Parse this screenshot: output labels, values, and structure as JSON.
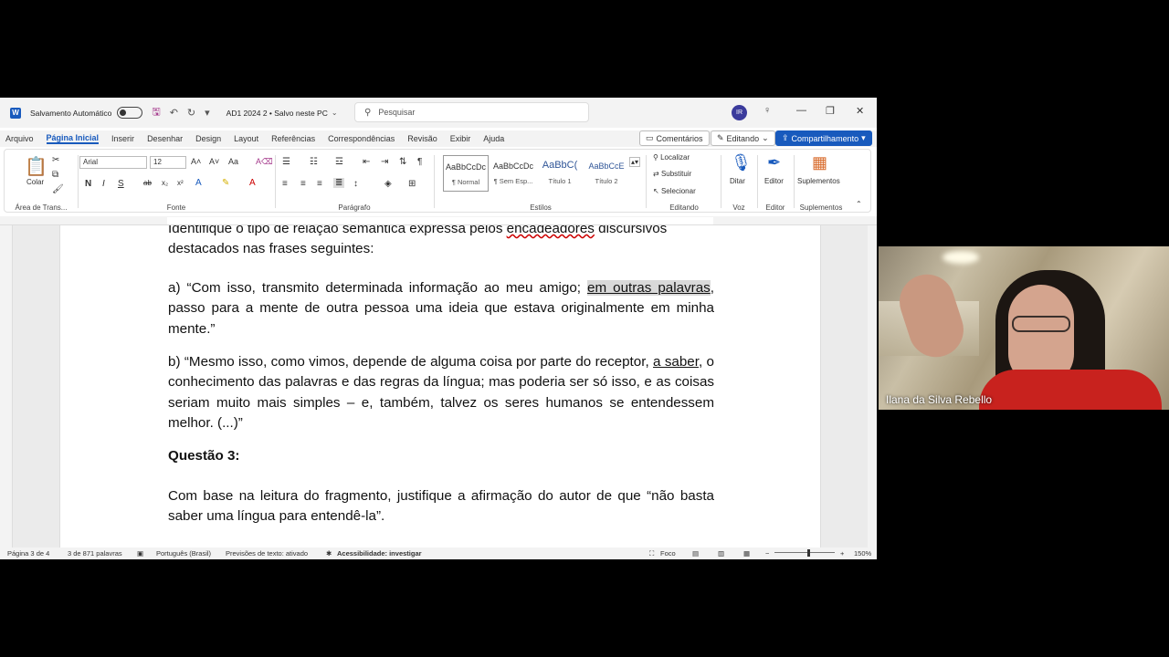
{
  "titlebar": {
    "autosave_label": "Salvamento Automático",
    "doc_name": "AD1 2024 2 • Salvo neste PC",
    "search_placeholder": "Pesquisar",
    "avatar_initials": "IR"
  },
  "menu": {
    "tabs": [
      "Arquivo",
      "Página Inicial",
      "Inserir",
      "Desenhar",
      "Design",
      "Layout",
      "Referências",
      "Correspondências",
      "Revisão",
      "Exibir",
      "Ajuda"
    ],
    "active_tab": "Página Inicial",
    "comments_label": "Comentários",
    "editing_label": "Editando",
    "share_label": "Compartilhamento"
  },
  "ribbon": {
    "clipboard": {
      "paste_label": "Colar",
      "group_label": "Área de Trans..."
    },
    "font": {
      "family": "Arial",
      "size": "12",
      "group_label": "Fonte"
    },
    "paragraph": {
      "group_label": "Parágrafo"
    },
    "styles": {
      "group_label": "Estilos",
      "items": [
        {
          "sample": "AaBbCcDc",
          "name": "¶ Normal"
        },
        {
          "sample": "AaBbCcDc",
          "name": "¶ Sem Esp..."
        },
        {
          "sample": "AaBbC(",
          "name": "Título 1"
        },
        {
          "sample": "AaBbCcE",
          "name": "Título 2"
        }
      ]
    },
    "editing": {
      "find": "Localizar",
      "replace": "Substituir",
      "select": "Selecionar",
      "group_label": "Editando"
    },
    "voice": {
      "dictate": "Ditar",
      "group_label": "Voz"
    },
    "editor": {
      "label": "Editor",
      "group_label": "Editor"
    },
    "addins": {
      "label": "Suplementos",
      "group_label": "Suplementos"
    }
  },
  "document": {
    "line_top_a": "Identifique o tipo de relação semântica expressa pelos ",
    "line_top_b": "encadeadores",
    "line_top_c": " discursivos",
    "line_top_2": "destacados nas frases seguintes:",
    "para_a_1": "a) “Com isso, transmito determinada informação ao meu amigo; ",
    "para_a_hl": "em outras palavras",
    "para_a_2": ", passo para a mente de outra pessoa uma ideia que estava originalmente em minha mente.”",
    "para_b_1": "b) “Mesmo isso, como vimos, depende de alguma coisa por parte do receptor, ",
    "para_b_ul": "a saber",
    "para_b_2": ", o conhecimento das palavras e das regras da língua; mas poderia ser só isso, e as coisas seriam muito mais simples – e, também, talvez os seres humanos se entendessem melhor. (...)”",
    "question_title": "Questão 3:",
    "question_text": "Com base na leitura do fragmento, justifique a afirmação do autor de que “não basta saber uma língua para entendê-la”."
  },
  "statusbar": {
    "page": "Página 3 de 4",
    "words": "3 de 871 palavras",
    "language": "Português (Brasil)",
    "predictions": "Previsões de texto: ativado",
    "accessibility": "Acessibilidade: investigar",
    "focus": "Foco",
    "zoom": "150%"
  },
  "webcam": {
    "participant_name": "Ilana da Silva Rebello"
  }
}
